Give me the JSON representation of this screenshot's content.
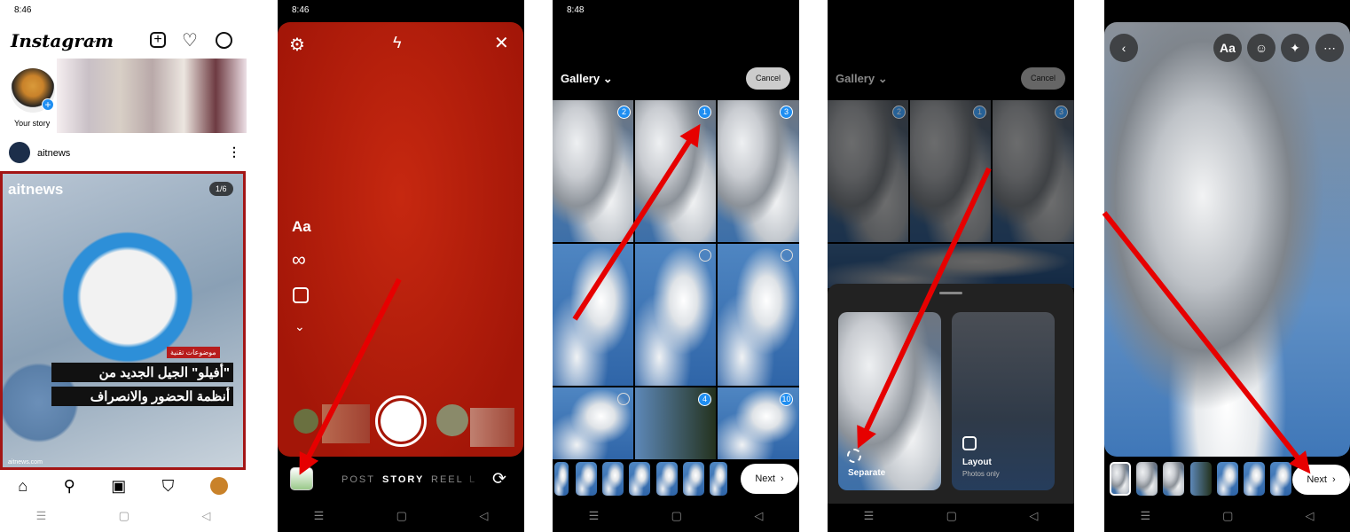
{
  "panel1": {
    "time": "8:46",
    "logo": "Instagram",
    "your_story": "Your story",
    "post_user": "aitnews",
    "post_counter": "1/6",
    "post_brand": "aitnews",
    "post_tag": "موضوعات تقنية",
    "post_headline_1": "\"أفيلو\" الجيل الجديد من",
    "post_headline_2": "أنظمة الحضور والانصراف",
    "post_watermark": "aitnews.com",
    "nav": [
      "home-icon",
      "search-icon",
      "reels-icon",
      "shop-icon",
      "profile-icon"
    ]
  },
  "panel2": {
    "time": "8:46",
    "tools": {
      "text": "Aa",
      "boomerang": "∞"
    },
    "modes": [
      "POST",
      "STORY",
      "REEL",
      "L"
    ],
    "active_mode": "STORY",
    "camera_bg": "#b71c0c"
  },
  "panel3": {
    "time": "8:48",
    "gallery": "Gallery",
    "cancel": "Cancel",
    "selection_numbers": [
      "2",
      "1",
      "3",
      "4",
      "10"
    ],
    "next": "Next"
  },
  "panel4": {
    "gallery": "Gallery",
    "cancel": "Cancel",
    "selection_numbers": [
      "2",
      "1",
      "3"
    ],
    "separate": "Separate",
    "layout": "Layout",
    "layout_sub": "Photos only"
  },
  "panel5": {
    "text_tool": "Aa",
    "next": "Next"
  },
  "colors": {
    "accent_blue": "#1f8ef1",
    "arrow_red": "#e60000"
  }
}
